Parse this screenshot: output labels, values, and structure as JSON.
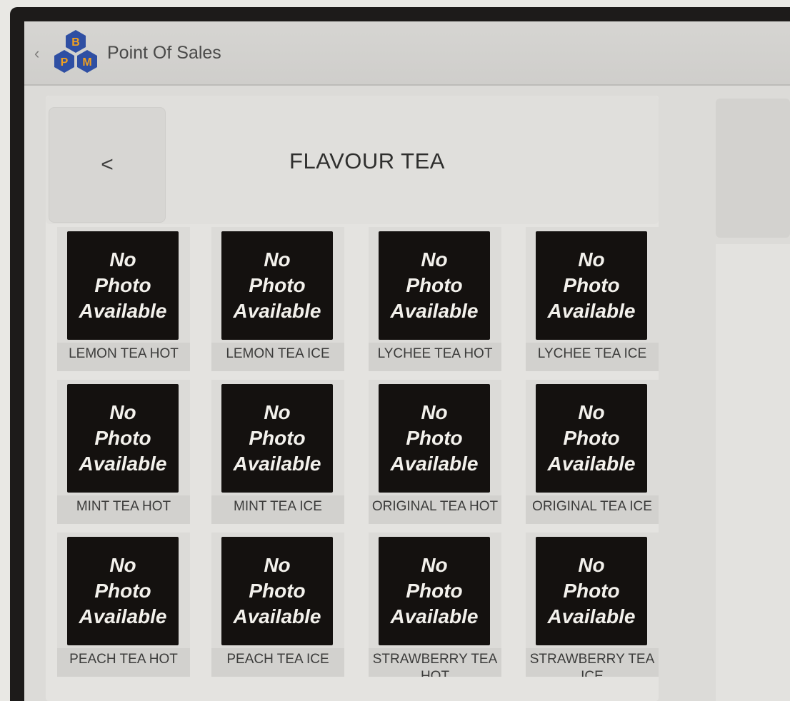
{
  "app": {
    "title": "Point Of Sales",
    "logo_letters": [
      "B",
      "P",
      "M"
    ]
  },
  "category": {
    "back_label": "<",
    "title": "FLAVOUR TEA"
  },
  "placeholder_image_text": [
    "No",
    "Photo",
    "Available"
  ],
  "items": [
    {
      "label": "LEMON TEA HOT"
    },
    {
      "label": "LEMON TEA ICE"
    },
    {
      "label": "LYCHEE TEA HOT"
    },
    {
      "label": "LYCHEE TEA ICE"
    },
    {
      "label": "MINT TEA HOT"
    },
    {
      "label": "MINT TEA ICE"
    },
    {
      "label": "ORIGINAL TEA HOT"
    },
    {
      "label": "ORIGINAL TEA ICE"
    },
    {
      "label": "PEACH TEA HOT"
    },
    {
      "label": "PEACH TEA ICE"
    },
    {
      "label": "STRAWBERRY TEA HOT"
    },
    {
      "label": "STRAWBERRY TEA ICE"
    }
  ],
  "colors": {
    "logo_blue": "#2f4fa3",
    "logo_orange": "#f0a020",
    "photo_bg": "#14110f"
  }
}
